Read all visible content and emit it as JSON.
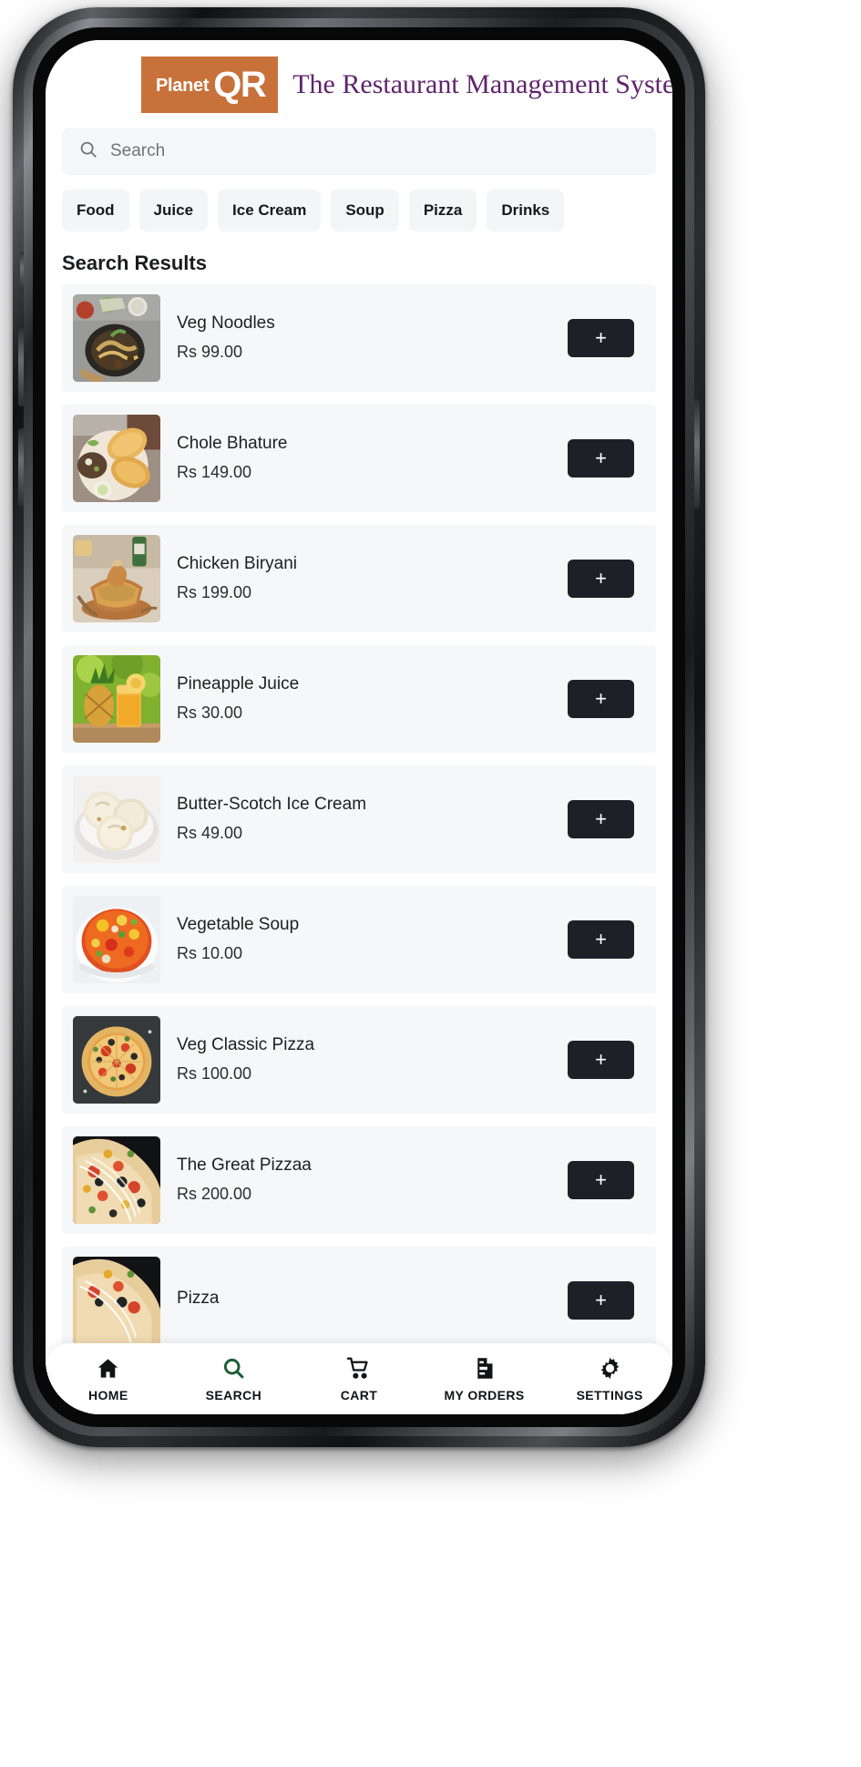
{
  "header": {
    "logo_planet": "Planet",
    "logo_qr": "QR",
    "logo_bg": "#c8713a",
    "title": "The Restaurant Management System",
    "title_color": "#61246e"
  },
  "search": {
    "placeholder": "Search",
    "value": "",
    "icon": "search-icon"
  },
  "categories": [
    {
      "label": "Food"
    },
    {
      "label": "Juice"
    },
    {
      "label": "Ice Cream"
    },
    {
      "label": "Soup"
    },
    {
      "label": "Pizza"
    },
    {
      "label": "Drinks"
    }
  ],
  "results": {
    "heading": "Search Results",
    "add_label": "+",
    "add_bg": "#1d2026",
    "items": [
      {
        "name": "Veg Noodles",
        "price": "Rs 99.00",
        "image": "veg-noodles-thumb"
      },
      {
        "name": "Chole Bhature",
        "price": "Rs 149.00",
        "image": "chole-bhature-thumb"
      },
      {
        "name": "Chicken Biryani",
        "price": "Rs 199.00",
        "image": "chicken-biryani-thumb"
      },
      {
        "name": "Pineapple Juice",
        "price": "Rs 30.00",
        "image": "pineapple-juice-thumb"
      },
      {
        "name": "Butter-Scotch Ice Cream",
        "price": "Rs 49.00",
        "image": "ice-cream-thumb"
      },
      {
        "name": "Vegetable Soup",
        "price": "Rs 10.00",
        "image": "vegetable-soup-thumb"
      },
      {
        "name": "Veg Classic Pizza",
        "price": "Rs 100.00",
        "image": "veg-classic-pizza-thumb"
      },
      {
        "name": "The Great Pizzaa",
        "price": "Rs 200.00",
        "image": "great-pizzaa-thumb"
      },
      {
        "name": "Pizza",
        "price": "",
        "image": "pizza-thumb"
      }
    ]
  },
  "bottom_nav": {
    "active": "SEARCH",
    "active_color": "#1b5e35",
    "inactive_color": "#121315",
    "items": [
      {
        "label": "HOME",
        "icon": "home-icon"
      },
      {
        "label": "SEARCH",
        "icon": "search-icon"
      },
      {
        "label": "CART",
        "icon": "cart-icon"
      },
      {
        "label": "MY ORDERS",
        "icon": "orders-document-icon"
      },
      {
        "label": "SETTINGS",
        "icon": "gear-icon"
      }
    ]
  }
}
